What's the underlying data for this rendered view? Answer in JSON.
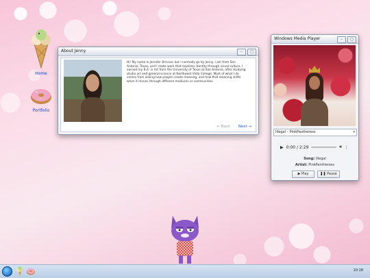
{
  "desktop": {
    "icons": [
      {
        "label": "Home",
        "icon": "ice-cream-cone-icon"
      },
      {
        "label": "Portfolio",
        "icon": "donut-icon"
      }
    ]
  },
  "about_window": {
    "title": "About Jenny",
    "bio": "Hi! My name is Jennifer Briscoe, but I normally go by Jenny. I am from San Antonio, Texas, and I make work that explores identity through visual culture. I earned my B.A. in Art from the University of Texas at San Antonio, after studying studio art and general science at Northwest Vista College. Most of what I do comes from asking how people create meaning, and how that meaning shifts when it moves through different mediums or communities.",
    "back_label": "← Back",
    "next_label": "Next →"
  },
  "player_window": {
    "title": "Windows Media Player",
    "selected_track": "Illegal – PinkPantheress",
    "time": "0:00 / 2:29",
    "progress": 0,
    "song_label": "Song:",
    "song_value": "Illegal",
    "artist_label": "Artist:",
    "artist_value": "PinkPantheress",
    "play_label": "▶ Play",
    "pause_label": "❚❚ Pause"
  },
  "taskbar": {
    "clock": "10:18",
    "icons": [
      "start-orb-icon",
      "ice-cream-cone-icon",
      "donut-icon"
    ]
  }
}
